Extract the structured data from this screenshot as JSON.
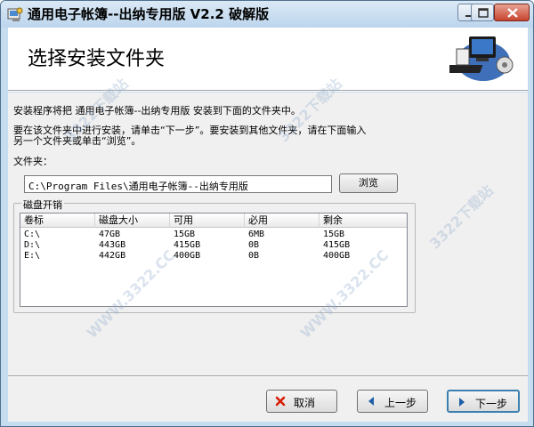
{
  "window": {
    "title": "通用电子帐簿--出纳专用版 V2.2 破解版"
  },
  "header": {
    "title": "选择安装文件夹"
  },
  "body": {
    "intro_line1": "安装程序将把 通用电子帐簿--出纳专用版 安装到下面的文件夹中。",
    "intro_line2": "要在该文件夹中进行安装，请单击“下一步”。要安装到其他文件夹，请在下面输入",
    "intro_line3": "另一个文件夹或单击“浏览”。",
    "folder_label": "文件夹：",
    "folder_value": "C:\\Program Files\\通用电子帐簿--出纳专用版",
    "browse_label": "浏览"
  },
  "disk_space": {
    "legend": "磁盘开销",
    "columns": [
      "卷标",
      "磁盘大小",
      "可用",
      "必用",
      "剩余"
    ],
    "rows": [
      [
        "C:\\",
        "47GB",
        "15GB",
        "6MB",
        "15GB"
      ],
      [
        "D:\\",
        "443GB",
        "415GB",
        "0B",
        "415GB"
      ],
      [
        "E:\\",
        "442GB",
        "400GB",
        "0B",
        "400GB"
      ]
    ]
  },
  "footer": {
    "cancel_label": "取消",
    "prev_label": "上一步",
    "next_label": "下一步"
  },
  "watermark": {
    "text": "3322下载站",
    "text_alt": "WWW.3322.CC"
  },
  "colors": {
    "accent": "#3c7fb1",
    "cancel_icon": "#d81e06",
    "nav_icon": "#1f5fa8"
  }
}
